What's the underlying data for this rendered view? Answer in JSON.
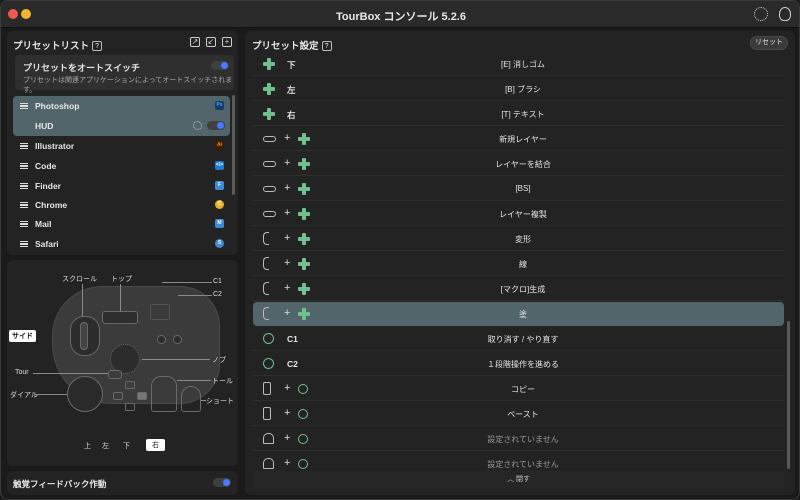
{
  "window": {
    "title": "TourBox コンソール 5.2.6"
  },
  "presets": {
    "header": "プリセットリスト",
    "help": "?",
    "auto_switch_title": "プリセットをオートスイッチ",
    "auto_switch_desc": "プリセットは関連アプリケーションによってオートスイッチされます。",
    "auto_switch_on": true,
    "items": [
      {
        "name": "Photoshop",
        "badge": "Ps",
        "badge_color": "#1b3a67",
        "selected": true
      },
      {
        "name": "HUD",
        "sub": true
      },
      {
        "name": "Illustrator",
        "badge": "Ai",
        "badge_color": "#3a1c05"
      },
      {
        "name": "Code",
        "badge": "</>",
        "badge_color": "#1e7ad3"
      },
      {
        "name": "Finder",
        "badge": "F",
        "badge_color": "#3d8bd8"
      },
      {
        "name": "Chrome",
        "badge": "C",
        "badge_color": "#e8b125"
      },
      {
        "name": "Mail",
        "badge": "M",
        "badge_color": "#3d8bd8"
      },
      {
        "name": "Safari",
        "badge": "S",
        "badge_color": "#3d8bd8"
      }
    ]
  },
  "device": {
    "labels": {
      "scroll": "スクロール",
      "top": "トップ",
      "c1": "C1",
      "c2": "C2",
      "side": "サイド",
      "knob": "ノブ",
      "tour": "Tour",
      "tall": "トール",
      "dial": "ダイアル",
      "short": "ショート",
      "up": "上",
      "left": "左",
      "down": "下",
      "right": "右"
    }
  },
  "haptic": {
    "label": "触覚フィードバック作動",
    "on": true
  },
  "settings": {
    "title": "プリセット設定",
    "help": "?",
    "reset_label": "リセット",
    "collapse_label": "閉す",
    "rows": [
      {
        "icon": "dpad",
        "key": "下",
        "action": "[E] 消しゴム"
      },
      {
        "icon": "dpad",
        "key": "左",
        "action": "[B] ブラシ"
      },
      {
        "icon": "dpad",
        "key": "右",
        "action": "[T] テキスト"
      },
      {
        "icon": "pill",
        "combo": "dpad",
        "action": "新規レイヤー"
      },
      {
        "icon": "pill",
        "combo": "dpad",
        "action": "レイヤーを結合"
      },
      {
        "icon": "pill",
        "combo": "dpad",
        "action": "[BS]"
      },
      {
        "icon": "pill",
        "combo": "dpad",
        "action": "レイヤー複製"
      },
      {
        "icon": "bracket",
        "combo": "dpad",
        "action": "変形"
      },
      {
        "icon": "bracket",
        "combo": "dpad",
        "action": "線"
      },
      {
        "icon": "bracket",
        "combo": "dpad",
        "action": "[マクロ]生成"
      },
      {
        "icon": "bracket",
        "combo": "dpad",
        "action": "塗",
        "active": true
      },
      {
        "icon": "circle",
        "key": "C1",
        "action": "取り消す / やり直す"
      },
      {
        "icon": "circle",
        "key": "C2",
        "action": "１段階操作を進める"
      },
      {
        "icon": "tall",
        "combo": "circle",
        "action": "コピー"
      },
      {
        "icon": "tall",
        "combo": "circle",
        "action": "ペースト"
      },
      {
        "icon": "dome",
        "combo": "circle",
        "action": "設定されていません",
        "unset": true
      },
      {
        "icon": "dome",
        "combo": "circle",
        "action": "設定されていません",
        "unset": true
      }
    ]
  }
}
